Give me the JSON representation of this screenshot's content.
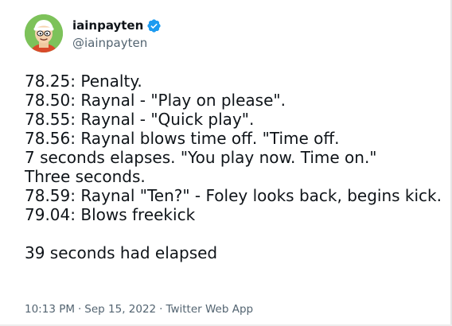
{
  "tweet": {
    "author": {
      "display_name": "iainpayten",
      "handle": "@iainpayten",
      "verified": true,
      "avatar_icon": "avatar-icon",
      "verified_icon": "verified-badge-icon",
      "accent_color": "#1d9bf0"
    },
    "lines": [
      "78.25: Penalty.",
      "78.50: Raynal - \"Play on please\".",
      "78.55: Raynal - \"Quick play\".",
      "78.56: Raynal blows time off. \"Time off.",
      "7 seconds elapses. \"You play now. Time on.\"",
      "Three seconds.",
      "78.59: Raynal \"Ten?\" - Foley looks back, begins kick.",
      "79.04: Blows freekick",
      "",
      "39 seconds had elapsed"
    ],
    "meta": {
      "time": "10:13 PM",
      "separator": "·",
      "date": "Sep 15, 2022",
      "source": "Twitter Web App"
    }
  }
}
